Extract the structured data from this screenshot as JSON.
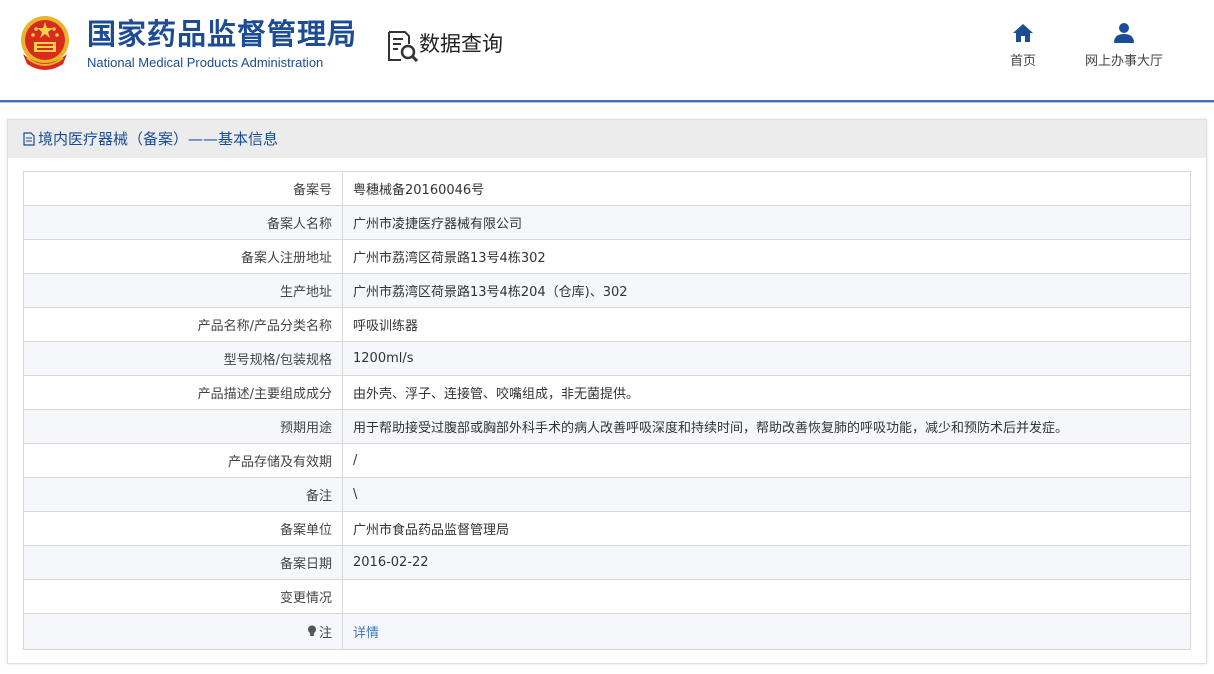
{
  "header": {
    "org_name_cn": "国家药品监督管理局",
    "org_name_en": "National Medical Products Administration",
    "data_query": "数据查询",
    "nav": [
      {
        "label": "首页",
        "icon": "home-icon"
      },
      {
        "label": "网上办事大厅",
        "icon": "user-icon"
      }
    ],
    "accent_color": "#1c4c95"
  },
  "panel": {
    "title": "境内医疗器械（备案）——基本信息",
    "rows": [
      {
        "label": "备案号",
        "value": "粤穗械备20160046号"
      },
      {
        "label": "备案人名称",
        "value": "广州市凌捷医疗器械有限公司"
      },
      {
        "label": "备案人注册地址",
        "value": "广州市荔湾区荷景路13号4栋302"
      },
      {
        "label": "生产地址",
        "value": "广州市荔湾区荷景路13号4栋204（仓库)、302"
      },
      {
        "label": "产品名称/产品分类名称",
        "value": "呼吸训练器"
      },
      {
        "label": "型号规格/包装规格",
        "value": "1200ml/s"
      },
      {
        "label": "产品描述/主要组成成分",
        "value": "由外壳、浮子、连接管、咬嘴组成，非无菌提供。"
      },
      {
        "label": "预期用途",
        "value": "用于帮助接受过腹部或胸部外科手术的病人改善呼吸深度和持续时间，帮助改善恢复肺的呼吸功能，减少和预防术后并发症。"
      },
      {
        "label": "产品存储及有效期",
        "value": "/"
      },
      {
        "label": "备注",
        "value": "\\"
      },
      {
        "label": "备案单位",
        "value": "广州市食品药品监督管理局"
      },
      {
        "label": "备案日期",
        "value": "2016-02-22"
      },
      {
        "label": "变更情况",
        "value": ""
      }
    ],
    "note": {
      "label": "注",
      "link": "详情"
    }
  }
}
